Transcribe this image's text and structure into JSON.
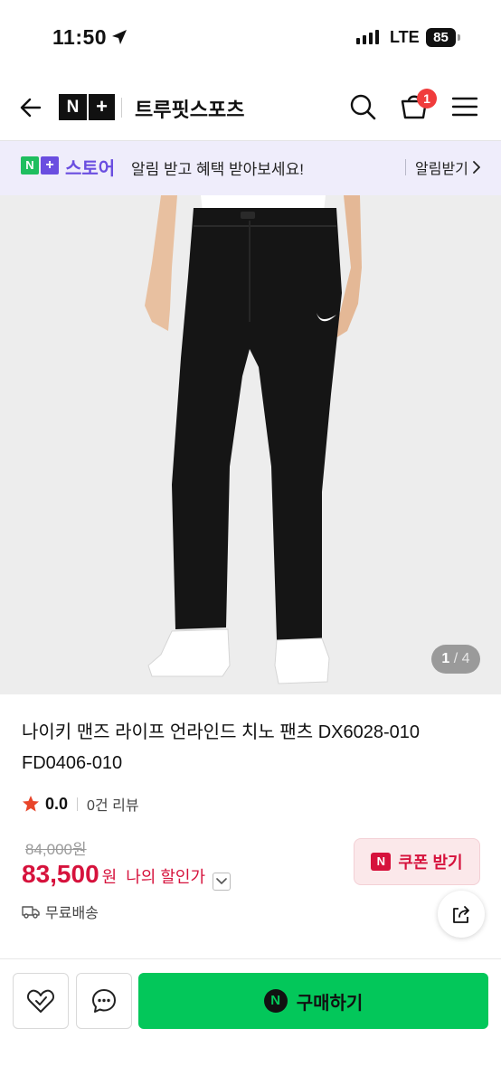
{
  "status_bar": {
    "time": "11:50",
    "network": "LTE",
    "battery": "85"
  },
  "header": {
    "logo_n": "N",
    "logo_plus": "+",
    "store_name": "트루핏스포츠",
    "cart_count": "1",
    "icons": [
      "back-arrow-icon",
      "search-icon",
      "cart-icon",
      "menu-icon"
    ]
  },
  "banner": {
    "logo_n": "N",
    "logo_plus": "+",
    "store_label": "스토어",
    "message": "알림 받고 혜택 받아보세요!",
    "cta": "알림받기"
  },
  "gallery": {
    "current": "1",
    "separator": " / ",
    "total": "4"
  },
  "product": {
    "title": "나이키 맨즈 라이프 언라인드 치노 팬츠 DX6028-010 FD0406-010",
    "rating": "0.0",
    "review_count": "0건 리뷰",
    "original_price": "84,000원",
    "price": "83,500",
    "currency": "원",
    "discount_label": "나의 할인가",
    "coupon_label": "쿠폰 받기",
    "coupon_logo": "N",
    "shipping": "무료배송"
  },
  "bottom_bar": {
    "buy_label": "구매하기",
    "pay_logo": "N"
  },
  "colors": {
    "brand_green": "#03c75a",
    "price_red": "#d6123c",
    "banner_bg": "#efedfb",
    "banner_purple": "#6a4ee0",
    "badge_red": "#f03c3c",
    "star": "#e8452a"
  }
}
